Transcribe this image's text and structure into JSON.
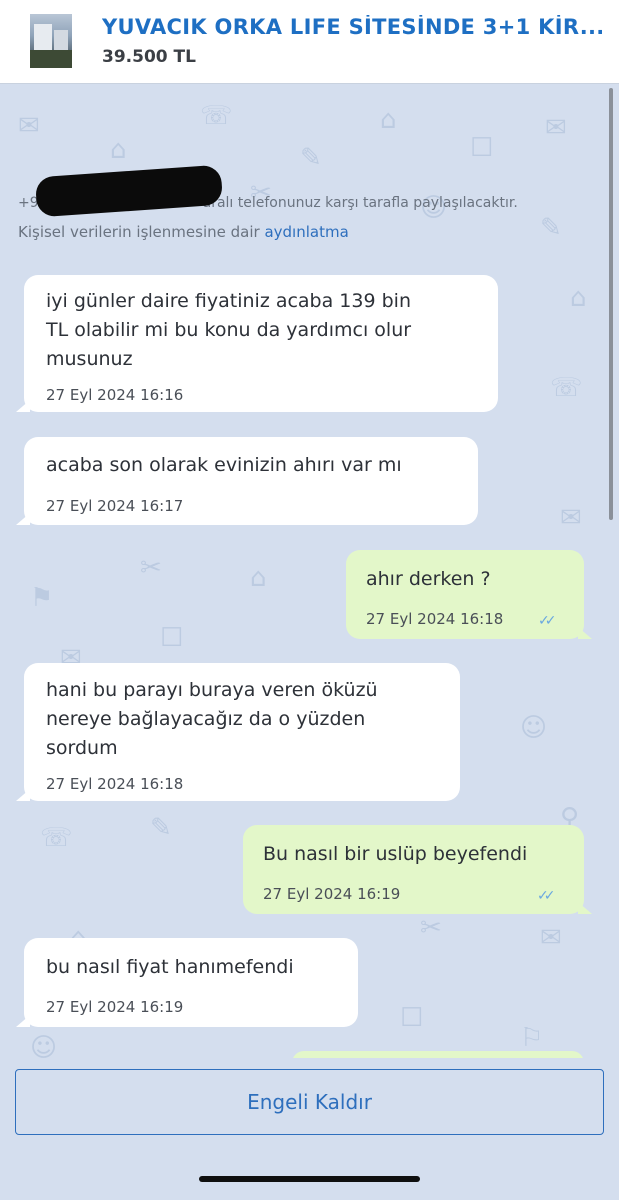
{
  "header": {
    "title": "YUVACIK ORKA LIFE SİTESİNDE 3+1 KİR...",
    "price": "39.500 TL"
  },
  "notice": {
    "line1_prefix": "+90-",
    "line1_suffix": "aralı telefonunuz karşı tarafla paylaşılacaktır.",
    "line2_text": "Kişisel verilerin işlenmesine dair",
    "line2_link": "aydınlatma"
  },
  "messages": [
    {
      "direction": "in",
      "text_lines": [
        "iyi günler daire fiyatiniz acaba 139 bin",
        "TL olabilir mi bu konu da yardımcı olur",
        "musunuz"
      ],
      "time": "27 Eyl 2024 16:16"
    },
    {
      "direction": "in",
      "text_lines": [
        "acaba son olarak evinizin ahırı var mı"
      ],
      "time": "27 Eyl 2024 16:17"
    },
    {
      "direction": "out",
      "text_lines": [
        "ahır derken ?"
      ],
      "time": "27 Eyl 2024 16:18",
      "read": true
    },
    {
      "direction": "in",
      "text_lines": [
        "hani bu parayı buraya veren öküzü",
        "nereye bağlayacağız da o yüzden",
        "sordum"
      ],
      "time": "27 Eyl 2024 16:18"
    },
    {
      "direction": "out",
      "text_lines": [
        "Bu nasıl bir uslüp beyefendi"
      ],
      "time": "27 Eyl 2024 16:19",
      "read": true
    },
    {
      "direction": "in",
      "text_lines": [
        "bu nasıl fiyat hanımefendi"
      ],
      "time": "27 Eyl 2024 16:19"
    }
  ],
  "actions": {
    "unblock_label": "Engeli Kaldır"
  },
  "colors": {
    "accent": "#2e6fbd",
    "chat_background": "#d4deee",
    "incoming_bubble": "#ffffff",
    "outgoing_bubble": "#e3f7c9",
    "read_ticks": "#6aa8e0"
  }
}
